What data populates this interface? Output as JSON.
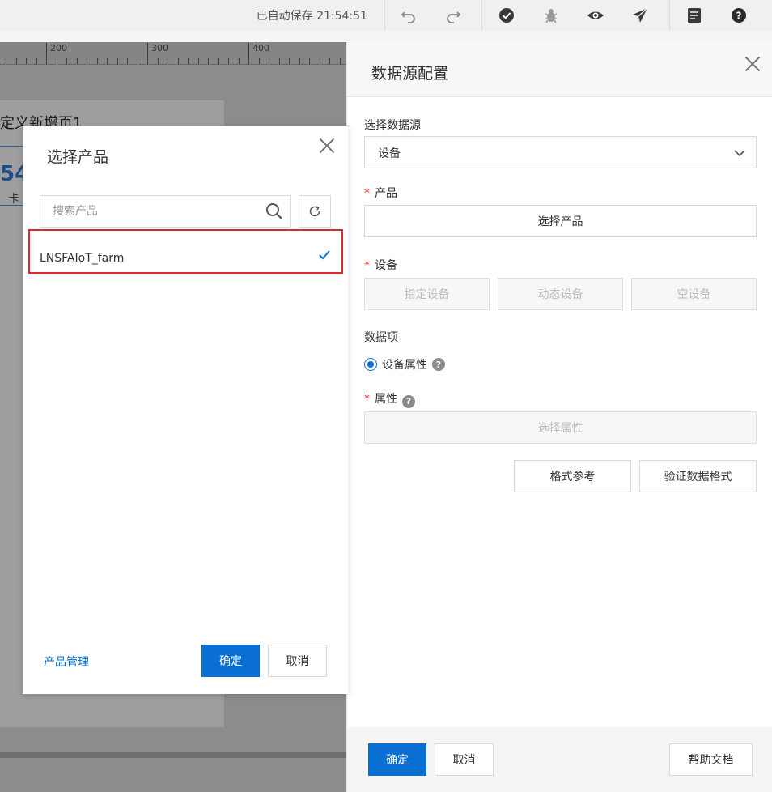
{
  "topbar": {
    "autosave": "已自动保存 21:54:51",
    "icons": [
      "undo-icon",
      "redo-icon",
      "check-circle-icon",
      "bug-icon",
      "eye-icon",
      "send-icon",
      "document-icon",
      "help-icon"
    ]
  },
  "canvas": {
    "ruler_labels": [
      "200",
      "300",
      "400"
    ],
    "page_title": "定义新增页1",
    "page_number": "54",
    "page_sub": "卡"
  },
  "panel": {
    "title": "数据源配置",
    "datasource_label": "选择数据源",
    "datasource_value": "设备",
    "product_label": "产品",
    "select_product_button": "选择产品",
    "device_label": "设备",
    "device_buttons": [
      "指定设备",
      "动态设备",
      "空设备"
    ],
    "data_item_label": "数据项",
    "radio_device_property": "设备属性",
    "property_label": "属性",
    "select_property_button": "选择属性",
    "format_reference_button": "格式参考",
    "validate_format_button": "验证数据格式",
    "confirm_button": "确定",
    "cancel_button": "取消",
    "help_doc_button": "帮助文档"
  },
  "modal": {
    "title": "选择产品",
    "search_placeholder": "搜索产品",
    "products": [
      {
        "name": "LNSFAIoT_farm",
        "selected": true
      }
    ],
    "manage_link": "产品管理",
    "confirm_button": "确定",
    "cancel_button": "取消"
  },
  "colors": {
    "primary": "#0a6fd3",
    "required": "#e02020",
    "highlight_border": "#e02828"
  }
}
